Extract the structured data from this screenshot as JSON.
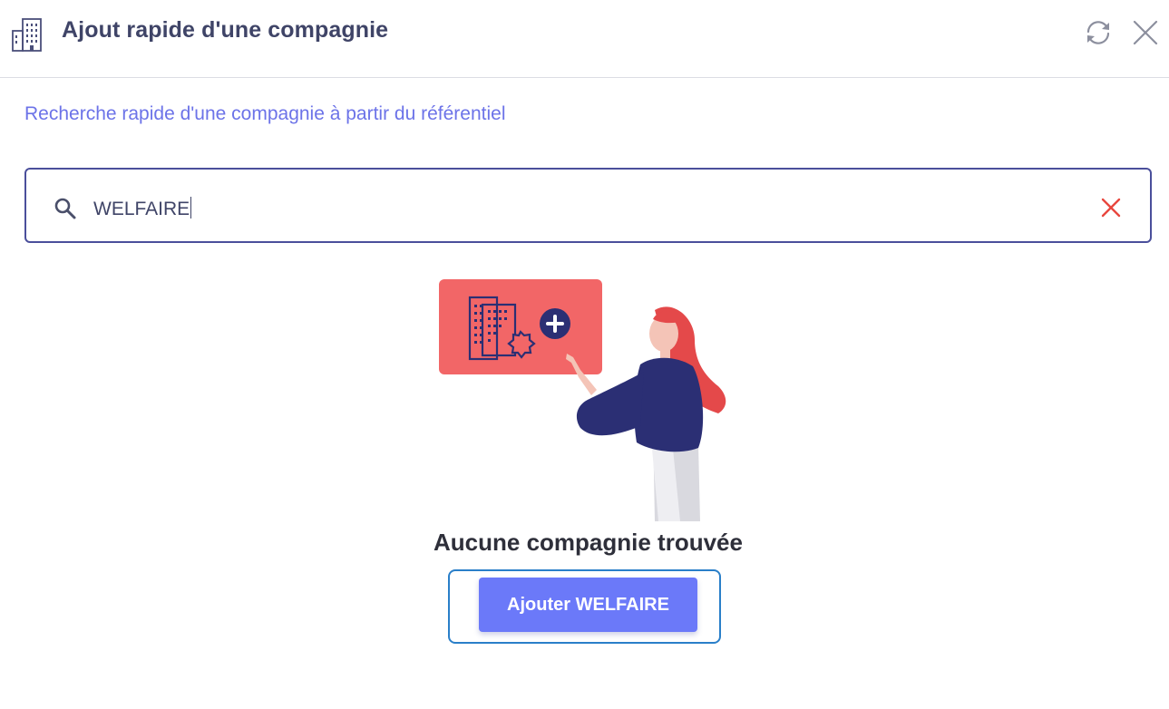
{
  "header": {
    "title": "Ajout rapide d'une compagnie",
    "icons": [
      "building-icon",
      "refresh-icon",
      "close-icon"
    ]
  },
  "subtitle": "Recherche rapide d'une compagnie à partir du référentiel",
  "search": {
    "value": "WELFAIRE",
    "icon": "search-icon",
    "clear_icon": "clear-icon"
  },
  "empty_state": {
    "message": "Aucune compagnie trouvée",
    "illustration": "woman-pointing-at-add-company-card",
    "action_label": "Ajouter WELFAIRE"
  },
  "colors": {
    "title": "#3f4467",
    "subtitle": "#6c73e8",
    "search_border": "#4a4f9b",
    "clear": "#e8473e",
    "button": "#6b79f9",
    "highlight": "#2a7fc9",
    "card": "#f26667",
    "navy": "#2b2f74"
  }
}
